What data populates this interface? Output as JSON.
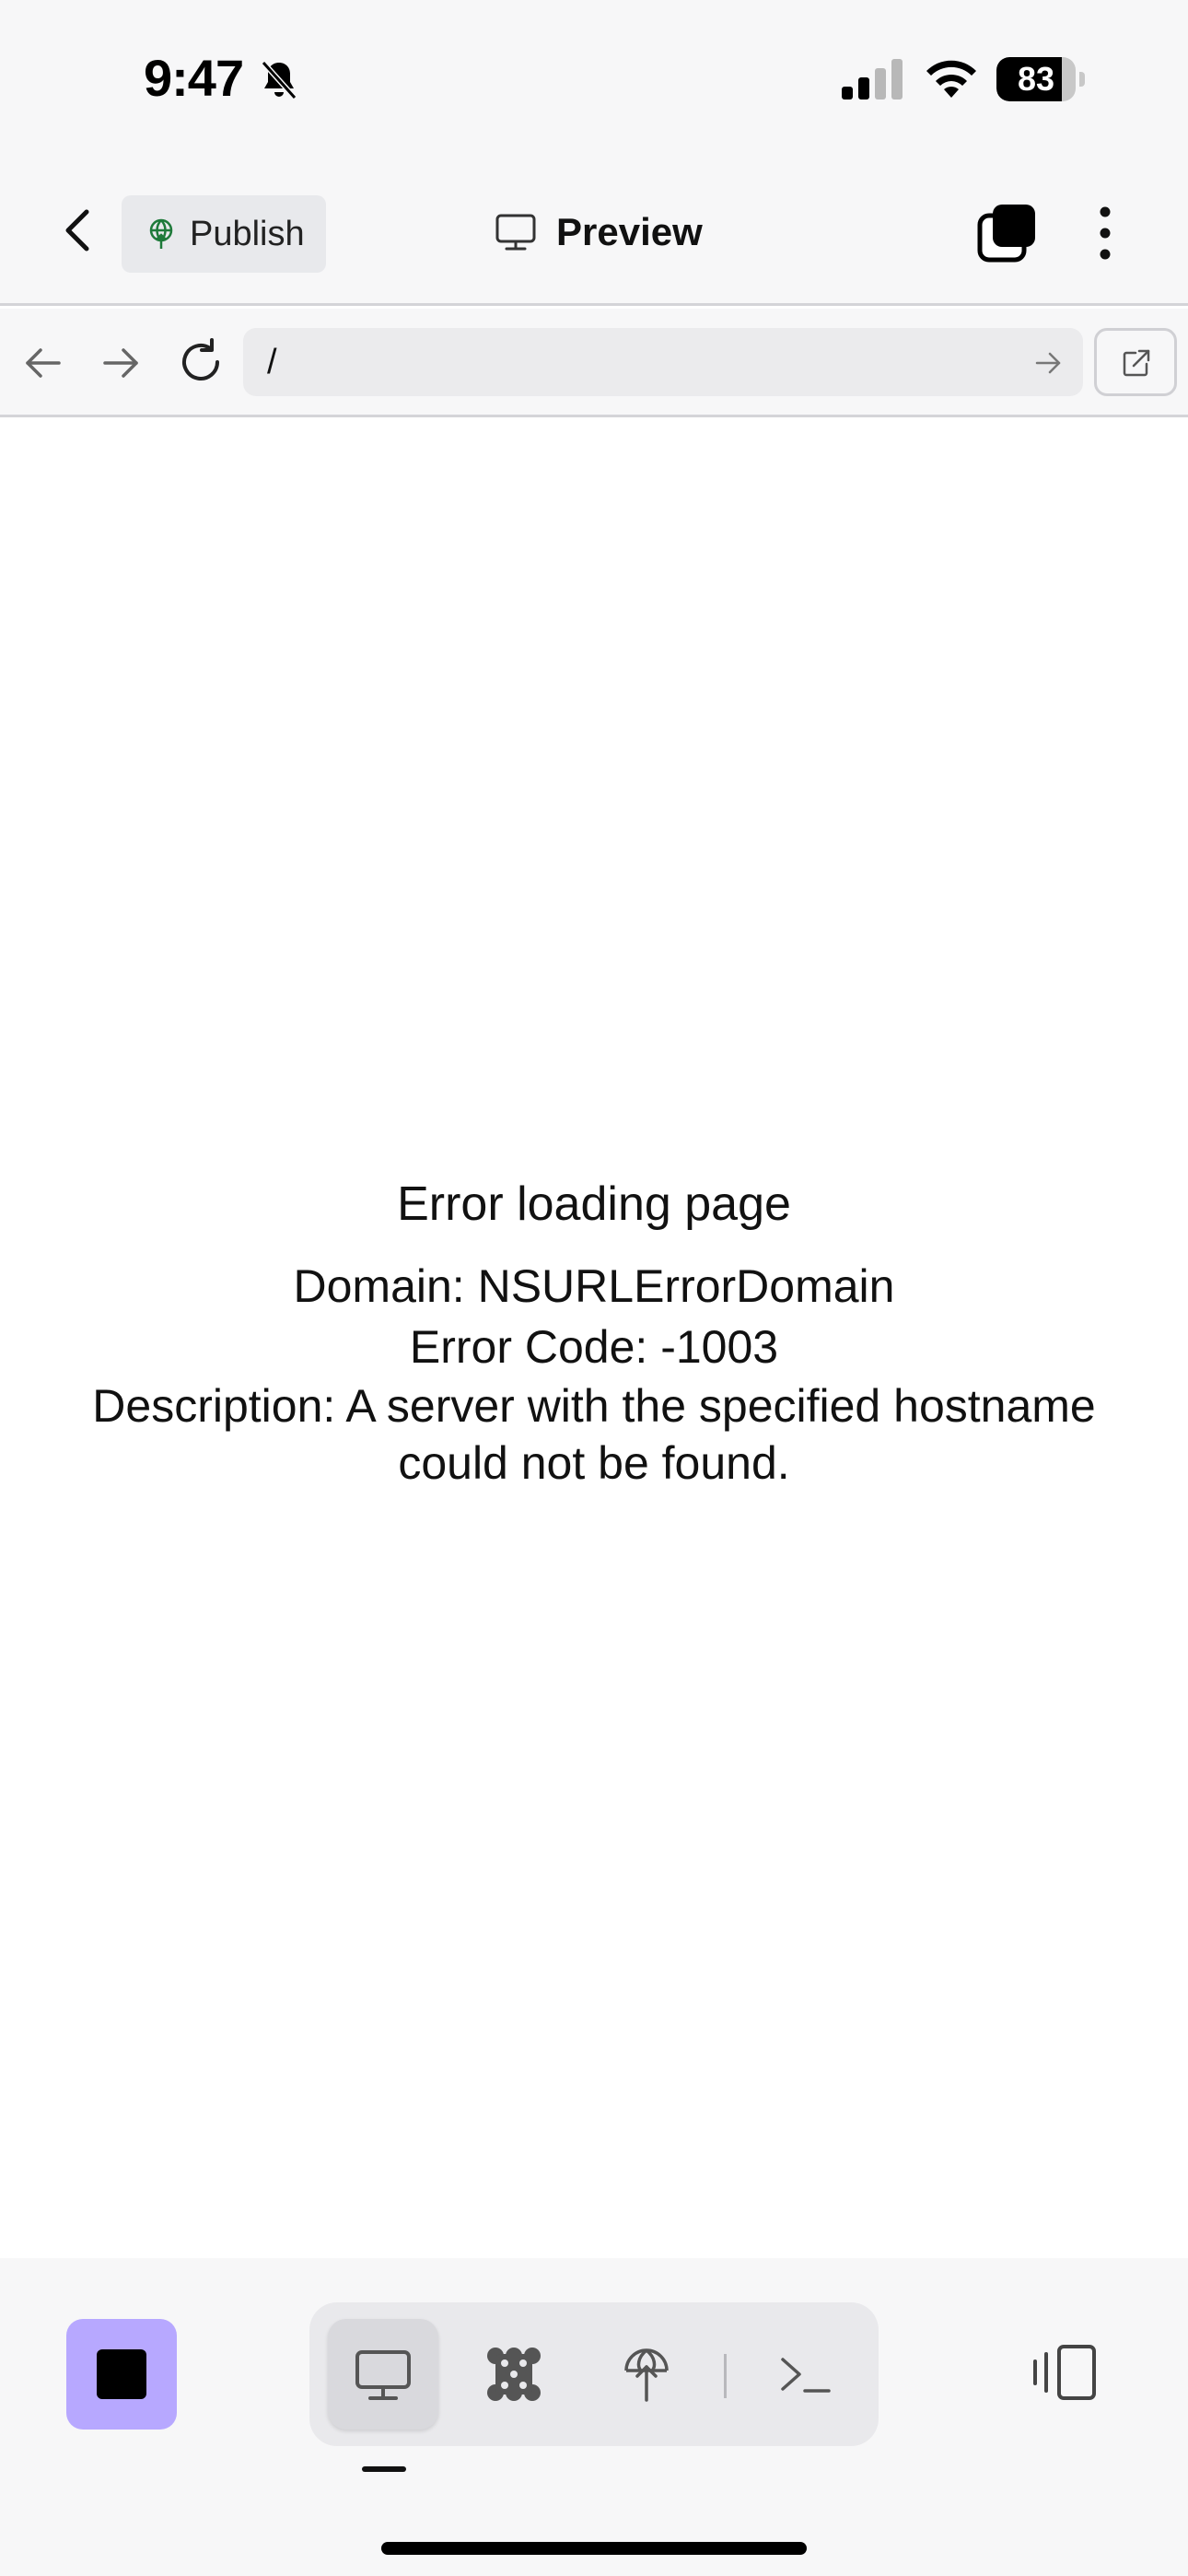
{
  "status_bar": {
    "time": "9:47",
    "battery_percent": 83,
    "battery_label": "83",
    "icons": [
      "bell-slash-icon",
      "cellular-signal-icon",
      "wifi-icon",
      "battery-icon"
    ]
  },
  "header": {
    "publish_label": "Publish",
    "title": "Preview",
    "icons": [
      "chevron-left-icon",
      "globe-icon",
      "monitor-icon",
      "tabs-icon",
      "more-vertical-icon"
    ]
  },
  "url_bar": {
    "address": "/",
    "icons": [
      "arrow-left-icon",
      "arrow-right-icon",
      "reload-icon",
      "go-arrow-icon",
      "external-link-icon"
    ]
  },
  "page": {
    "error_title": "Error loading page",
    "domain_line": "Domain: NSURLErrorDomain",
    "code_line": "Error Code: -1003",
    "description_line": "Description: A server with the specified hostname could not be found."
  },
  "toolbar": {
    "tools": [
      "monitor-icon",
      "network-icon",
      "globe-icon",
      "terminal-icon"
    ],
    "active_tool": "monitor-icon"
  },
  "colors": {
    "accent": "#b7a8ff",
    "bar_background": "#f7f7f8"
  }
}
